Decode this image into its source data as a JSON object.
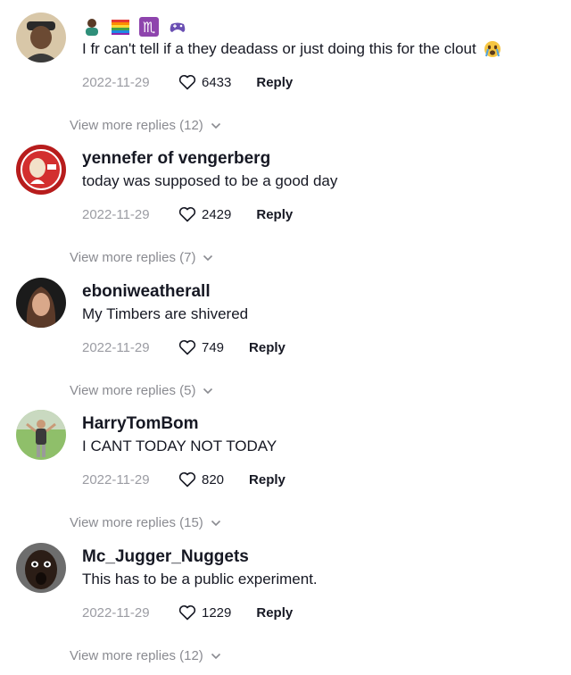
{
  "comments": [
    {
      "username": "",
      "name_icons": [
        "person-emoji-icon",
        "rainbow-flag-icon",
        "scorpio-icon",
        "game-controller-icon"
      ],
      "text": "I fr can't tell if a they deadass or just doing this for the clout",
      "trailing_emoji": "crying-face-emoji-icon",
      "date": "2022-11-29",
      "likes": "6433",
      "reply_label": "Reply",
      "view_more": "View more replies (12)"
    },
    {
      "username": "yennefer of vengerberg",
      "text": "today was supposed to be a good day",
      "date": "2022-11-29",
      "likes": "2429",
      "reply_label": "Reply",
      "view_more": "View more replies (7)"
    },
    {
      "username": "eboniweatherall",
      "text": "My Timbers are shivered",
      "date": "2022-11-29",
      "likes": "749",
      "reply_label": "Reply",
      "view_more": "View more replies (5)"
    },
    {
      "username": "HarryTomBom",
      "text": "I CANT TODAY NOT TODAY",
      "date": "2022-11-29",
      "likes": "820",
      "reply_label": "Reply",
      "view_more": "View more replies (15)"
    },
    {
      "username": "Mc_Jugger_Nuggets",
      "text": "This has to be a public experiment.",
      "date": "2022-11-29",
      "likes": "1229",
      "reply_label": "Reply",
      "view_more": "View more replies (12)"
    }
  ],
  "colors": {
    "text": "#161823",
    "muted": "#9b9ca3",
    "view_more": "#8a8b91"
  }
}
